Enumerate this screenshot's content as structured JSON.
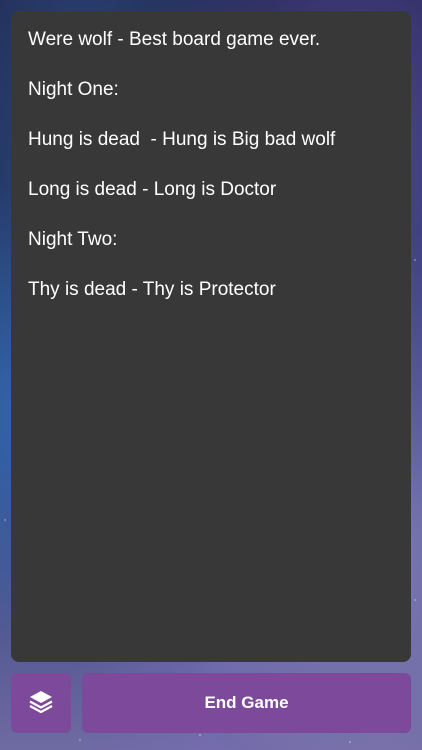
{
  "log": {
    "lines": [
      "Were wolf - Best board game ever.",
      "Night One:",
      "Hung is dead  - Hung is Big bad wolf",
      "Long is dead - Long is Doctor",
      "Night Two:",
      "Thy is dead - Thy is Protector"
    ]
  },
  "footer": {
    "layers_icon": "layers-icon",
    "end_game_label": "End Game"
  },
  "colors": {
    "panel": "#383838",
    "button": "#7d4a9b"
  }
}
